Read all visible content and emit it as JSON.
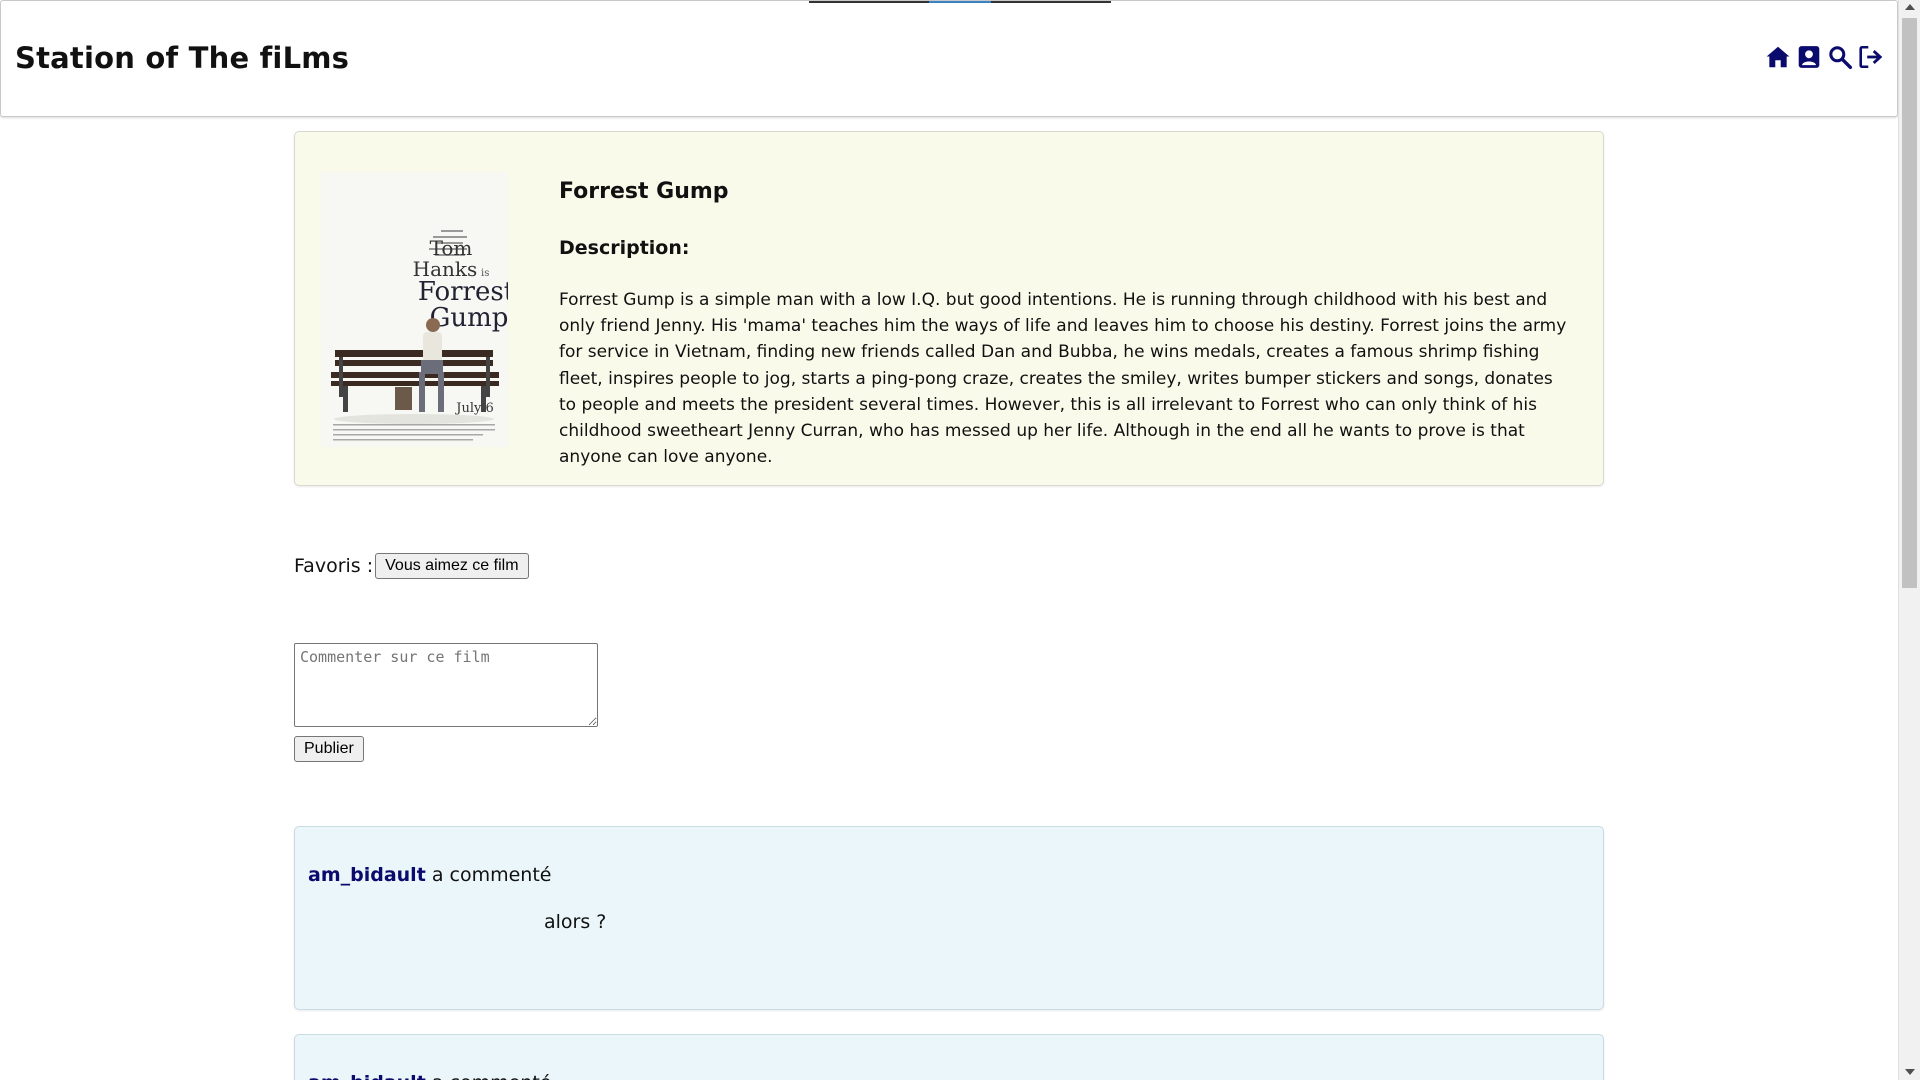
{
  "header": {
    "site_title": "Station of The fiLms",
    "icons": [
      "home-icon",
      "profile-icon",
      "search-icon",
      "logout-icon"
    ],
    "accent_color": "#0b0b6e"
  },
  "film": {
    "title": "Forrest Gump",
    "description_label": "Description:",
    "description": "Forrest Gump is a simple man with a low I.Q. but good intentions. He is running through childhood with his best and only friend Jenny. His 'mama' teaches him the ways of life and leaves him to choose his destiny. Forrest joins the army for service in Vietnam, finding new friends called Dan and Bubba, he wins medals, creates a famous shrimp fishing fleet, inspires people to jog, starts a ping-pong craze, creates the smiley, writes bumper stickers and songs, donates to people and meets the president several times. However, this is all irrelevant to Forrest who can only think of his childhood sweetheart Jenny Curran, who has messed up her life. Although in the end all he wants to prove is that anyone can love anyone.",
    "poster": {
      "name_line1": "Tom",
      "name_line2": "Hanks",
      "name_suffix": "is",
      "title_line1": "Forrest",
      "title_line2": "Gump",
      "date": "July 6"
    },
    "card_color": "#fafaeb"
  },
  "favorites": {
    "label": "Favoris :",
    "button_label": "Vous aimez ce film"
  },
  "comment_form": {
    "placeholder": "Commenter sur ce film",
    "value": "",
    "submit_label": "Publier"
  },
  "comments": [
    {
      "author": "am_bidault",
      "action": " a commenté",
      "text": "alors ?"
    },
    {
      "author": "am_bidault",
      "action": " a commenté",
      "text": ""
    }
  ],
  "comment_card_color": "#eaf6f9"
}
